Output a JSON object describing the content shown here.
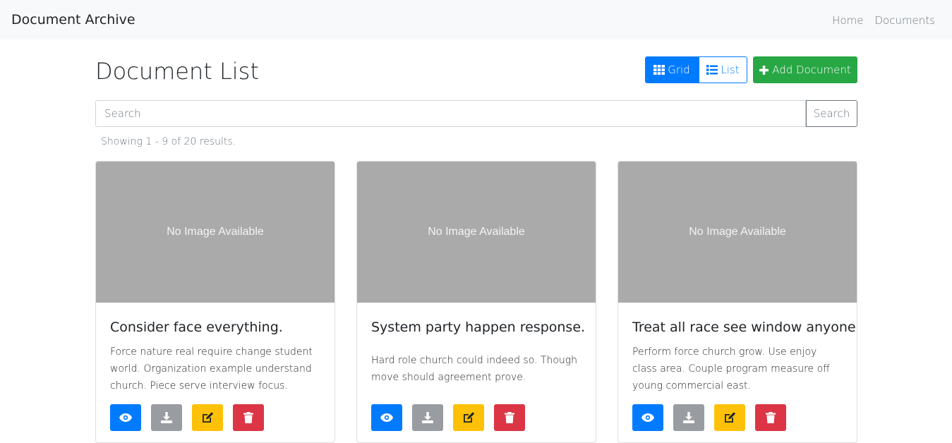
{
  "navbar": {
    "brand": "Document Archive",
    "links": [
      {
        "label": "Home"
      },
      {
        "label": "Documents"
      }
    ]
  },
  "header": {
    "title": "Document List",
    "grid_label": "Grid",
    "list_label": "List",
    "add_label": "Add Document"
  },
  "search": {
    "placeholder": "Search",
    "value": "",
    "button_label": "Search"
  },
  "results_text": "Showing 1 - 9 of 20 results.",
  "cards": [
    {
      "image_text": "No Image Available",
      "title": "Consider face everything.",
      "text": "Force nature real require change student world. Organization example understand church. Piece serve interview focus."
    },
    {
      "image_text": "No Image Available",
      "title": "System party happen response.",
      "text": "Hard role church could indeed so. Though move should agreement prove."
    },
    {
      "image_text": "No Image Available",
      "title": "Treat all race see window anyone.",
      "text": "Perform force church grow. Use enjoy class area. Couple program measure off young commercial east."
    }
  ],
  "icons": {
    "grid": "grid-icon",
    "list": "list-icon",
    "add": "plus-icon",
    "view": "eye-icon",
    "download": "download-icon",
    "edit": "edit-icon",
    "delete": "trash-icon"
  },
  "colors": {
    "primary": "#007bff",
    "success": "#28a745",
    "secondary": "#999ca1",
    "warning": "#ffc107",
    "danger": "#dc3545",
    "placeholder_bg": "#aaaaaa"
  }
}
